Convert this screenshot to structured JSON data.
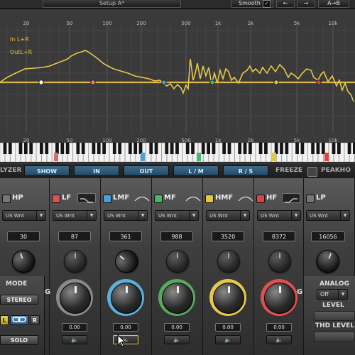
{
  "toolbar": {
    "preset": "Setup A*",
    "smooth_label": "Smooth",
    "smooth_checked": "✓",
    "undo_icon": "left-arrow-icon",
    "undo": "←",
    "redo_icon": "right-arrow-icon",
    "redo": "→",
    "ab_label": "A→B"
  },
  "graph": {
    "legend_in": "In L+R",
    "legend_out": "OutL+R",
    "freq_labels_top": [
      "20",
      "50",
      "100",
      "200",
      "500",
      "1k",
      "2k",
      "5k",
      "10k"
    ],
    "freq_labels_bottom": [
      "20",
      "50",
      "100",
      "200",
      "500",
      "1k",
      "2k",
      "5k",
      "10k"
    ],
    "colors": {
      "curve": "#e6c94a",
      "flat": "#e0b840",
      "bg": "#3a3a3a"
    }
  },
  "analyzer": {
    "label": "LYZER",
    "buttons": [
      "SHOW",
      "IN",
      "OUT",
      "L / M",
      "R / S"
    ],
    "freeze": "FREEZE",
    "peakhold": "PEAKHO"
  },
  "bands": [
    {
      "name": "HP",
      "led": "#777",
      "type": "US Wnt",
      "freq": "30",
      "gain": "",
      "color": ""
    },
    {
      "name": "LF",
      "led": "#e05050",
      "type": "US Wnt",
      "freq": "87",
      "gain": "0.00",
      "color": "#8a8a8a"
    },
    {
      "name": "LMF",
      "led": "#4aa0d8",
      "type": "US Wnt",
      "freq": "361",
      "gain": "0.00",
      "color": "#5ab0d8"
    },
    {
      "name": "MF",
      "led": "#45b86a",
      "type": "US Wnt",
      "freq": "988",
      "gain": "0.00",
      "color": "#5aa860"
    },
    {
      "name": "HMF",
      "led": "#e0c840",
      "type": "US Wnt",
      "freq": "3520",
      "gain": "0.00",
      "color": "#e6c94a"
    },
    {
      "name": "HF",
      "led": "#e04040",
      "type": "US Wnt",
      "freq": "8372",
      "gain": "0.00",
      "color": "#e05050"
    },
    {
      "name": "LP",
      "led": "#777",
      "type": "US Wnt",
      "freq": "16056",
      "gain": "",
      "color": ""
    }
  ],
  "gain_symbol": "G",
  "left_panel": {
    "mode_label": "MODE",
    "stereo": "STEREO",
    "l": "L",
    "link_icon": "link-icon",
    "r": "R",
    "solo": "SOLO"
  },
  "right_panel": {
    "analog_label": "ANALOG",
    "analog_value": "Off",
    "level_label": "LEVEL",
    "thd_label": "THD LEVEL"
  },
  "speaker_icon": "speaker-icon",
  "speaker_glyph": "🔈"
}
